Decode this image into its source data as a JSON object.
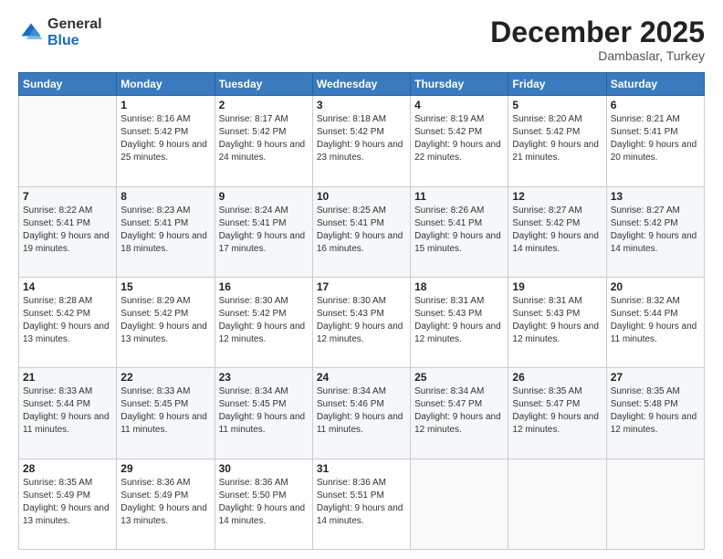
{
  "logo": {
    "general": "General",
    "blue": "Blue"
  },
  "header": {
    "month_year": "December 2025",
    "location": "Dambaslar, Turkey"
  },
  "days_of_week": [
    "Sunday",
    "Monday",
    "Tuesday",
    "Wednesday",
    "Thursday",
    "Friday",
    "Saturday"
  ],
  "weeks": [
    [
      {
        "day": "",
        "sunrise": "",
        "sunset": "",
        "daylight": ""
      },
      {
        "day": "1",
        "sunrise": "Sunrise: 8:16 AM",
        "sunset": "Sunset: 5:42 PM",
        "daylight": "Daylight: 9 hours and 25 minutes."
      },
      {
        "day": "2",
        "sunrise": "Sunrise: 8:17 AM",
        "sunset": "Sunset: 5:42 PM",
        "daylight": "Daylight: 9 hours and 24 minutes."
      },
      {
        "day": "3",
        "sunrise": "Sunrise: 8:18 AM",
        "sunset": "Sunset: 5:42 PM",
        "daylight": "Daylight: 9 hours and 23 minutes."
      },
      {
        "day": "4",
        "sunrise": "Sunrise: 8:19 AM",
        "sunset": "Sunset: 5:42 PM",
        "daylight": "Daylight: 9 hours and 22 minutes."
      },
      {
        "day": "5",
        "sunrise": "Sunrise: 8:20 AM",
        "sunset": "Sunset: 5:42 PM",
        "daylight": "Daylight: 9 hours and 21 minutes."
      },
      {
        "day": "6",
        "sunrise": "Sunrise: 8:21 AM",
        "sunset": "Sunset: 5:41 PM",
        "daylight": "Daylight: 9 hours and 20 minutes."
      }
    ],
    [
      {
        "day": "7",
        "sunrise": "Sunrise: 8:22 AM",
        "sunset": "Sunset: 5:41 PM",
        "daylight": "Daylight: 9 hours and 19 minutes."
      },
      {
        "day": "8",
        "sunrise": "Sunrise: 8:23 AM",
        "sunset": "Sunset: 5:41 PM",
        "daylight": "Daylight: 9 hours and 18 minutes."
      },
      {
        "day": "9",
        "sunrise": "Sunrise: 8:24 AM",
        "sunset": "Sunset: 5:41 PM",
        "daylight": "Daylight: 9 hours and 17 minutes."
      },
      {
        "day": "10",
        "sunrise": "Sunrise: 8:25 AM",
        "sunset": "Sunset: 5:41 PM",
        "daylight": "Daylight: 9 hours and 16 minutes."
      },
      {
        "day": "11",
        "sunrise": "Sunrise: 8:26 AM",
        "sunset": "Sunset: 5:41 PM",
        "daylight": "Daylight: 9 hours and 15 minutes."
      },
      {
        "day": "12",
        "sunrise": "Sunrise: 8:27 AM",
        "sunset": "Sunset: 5:42 PM",
        "daylight": "Daylight: 9 hours and 14 minutes."
      },
      {
        "day": "13",
        "sunrise": "Sunrise: 8:27 AM",
        "sunset": "Sunset: 5:42 PM",
        "daylight": "Daylight: 9 hours and 14 minutes."
      }
    ],
    [
      {
        "day": "14",
        "sunrise": "Sunrise: 8:28 AM",
        "sunset": "Sunset: 5:42 PM",
        "daylight": "Daylight: 9 hours and 13 minutes."
      },
      {
        "day": "15",
        "sunrise": "Sunrise: 8:29 AM",
        "sunset": "Sunset: 5:42 PM",
        "daylight": "Daylight: 9 hours and 13 minutes."
      },
      {
        "day": "16",
        "sunrise": "Sunrise: 8:30 AM",
        "sunset": "Sunset: 5:42 PM",
        "daylight": "Daylight: 9 hours and 12 minutes."
      },
      {
        "day": "17",
        "sunrise": "Sunrise: 8:30 AM",
        "sunset": "Sunset: 5:43 PM",
        "daylight": "Daylight: 9 hours and 12 minutes."
      },
      {
        "day": "18",
        "sunrise": "Sunrise: 8:31 AM",
        "sunset": "Sunset: 5:43 PM",
        "daylight": "Daylight: 9 hours and 12 minutes."
      },
      {
        "day": "19",
        "sunrise": "Sunrise: 8:31 AM",
        "sunset": "Sunset: 5:43 PM",
        "daylight": "Daylight: 9 hours and 12 minutes."
      },
      {
        "day": "20",
        "sunrise": "Sunrise: 8:32 AM",
        "sunset": "Sunset: 5:44 PM",
        "daylight": "Daylight: 9 hours and 11 minutes."
      }
    ],
    [
      {
        "day": "21",
        "sunrise": "Sunrise: 8:33 AM",
        "sunset": "Sunset: 5:44 PM",
        "daylight": "Daylight: 9 hours and 11 minutes."
      },
      {
        "day": "22",
        "sunrise": "Sunrise: 8:33 AM",
        "sunset": "Sunset: 5:45 PM",
        "daylight": "Daylight: 9 hours and 11 minutes."
      },
      {
        "day": "23",
        "sunrise": "Sunrise: 8:34 AM",
        "sunset": "Sunset: 5:45 PM",
        "daylight": "Daylight: 9 hours and 11 minutes."
      },
      {
        "day": "24",
        "sunrise": "Sunrise: 8:34 AM",
        "sunset": "Sunset: 5:46 PM",
        "daylight": "Daylight: 9 hours and 11 minutes."
      },
      {
        "day": "25",
        "sunrise": "Sunrise: 8:34 AM",
        "sunset": "Sunset: 5:47 PM",
        "daylight": "Daylight: 9 hours and 12 minutes."
      },
      {
        "day": "26",
        "sunrise": "Sunrise: 8:35 AM",
        "sunset": "Sunset: 5:47 PM",
        "daylight": "Daylight: 9 hours and 12 minutes."
      },
      {
        "day": "27",
        "sunrise": "Sunrise: 8:35 AM",
        "sunset": "Sunset: 5:48 PM",
        "daylight": "Daylight: 9 hours and 12 minutes."
      }
    ],
    [
      {
        "day": "28",
        "sunrise": "Sunrise: 8:35 AM",
        "sunset": "Sunset: 5:49 PM",
        "daylight": "Daylight: 9 hours and 13 minutes."
      },
      {
        "day": "29",
        "sunrise": "Sunrise: 8:36 AM",
        "sunset": "Sunset: 5:49 PM",
        "daylight": "Daylight: 9 hours and 13 minutes."
      },
      {
        "day": "30",
        "sunrise": "Sunrise: 8:36 AM",
        "sunset": "Sunset: 5:50 PM",
        "daylight": "Daylight: 9 hours and 14 minutes."
      },
      {
        "day": "31",
        "sunrise": "Sunrise: 8:36 AM",
        "sunset": "Sunset: 5:51 PM",
        "daylight": "Daylight: 9 hours and 14 minutes."
      },
      {
        "day": "",
        "sunrise": "",
        "sunset": "",
        "daylight": ""
      },
      {
        "day": "",
        "sunrise": "",
        "sunset": "",
        "daylight": ""
      },
      {
        "day": "",
        "sunrise": "",
        "sunset": "",
        "daylight": ""
      }
    ]
  ]
}
